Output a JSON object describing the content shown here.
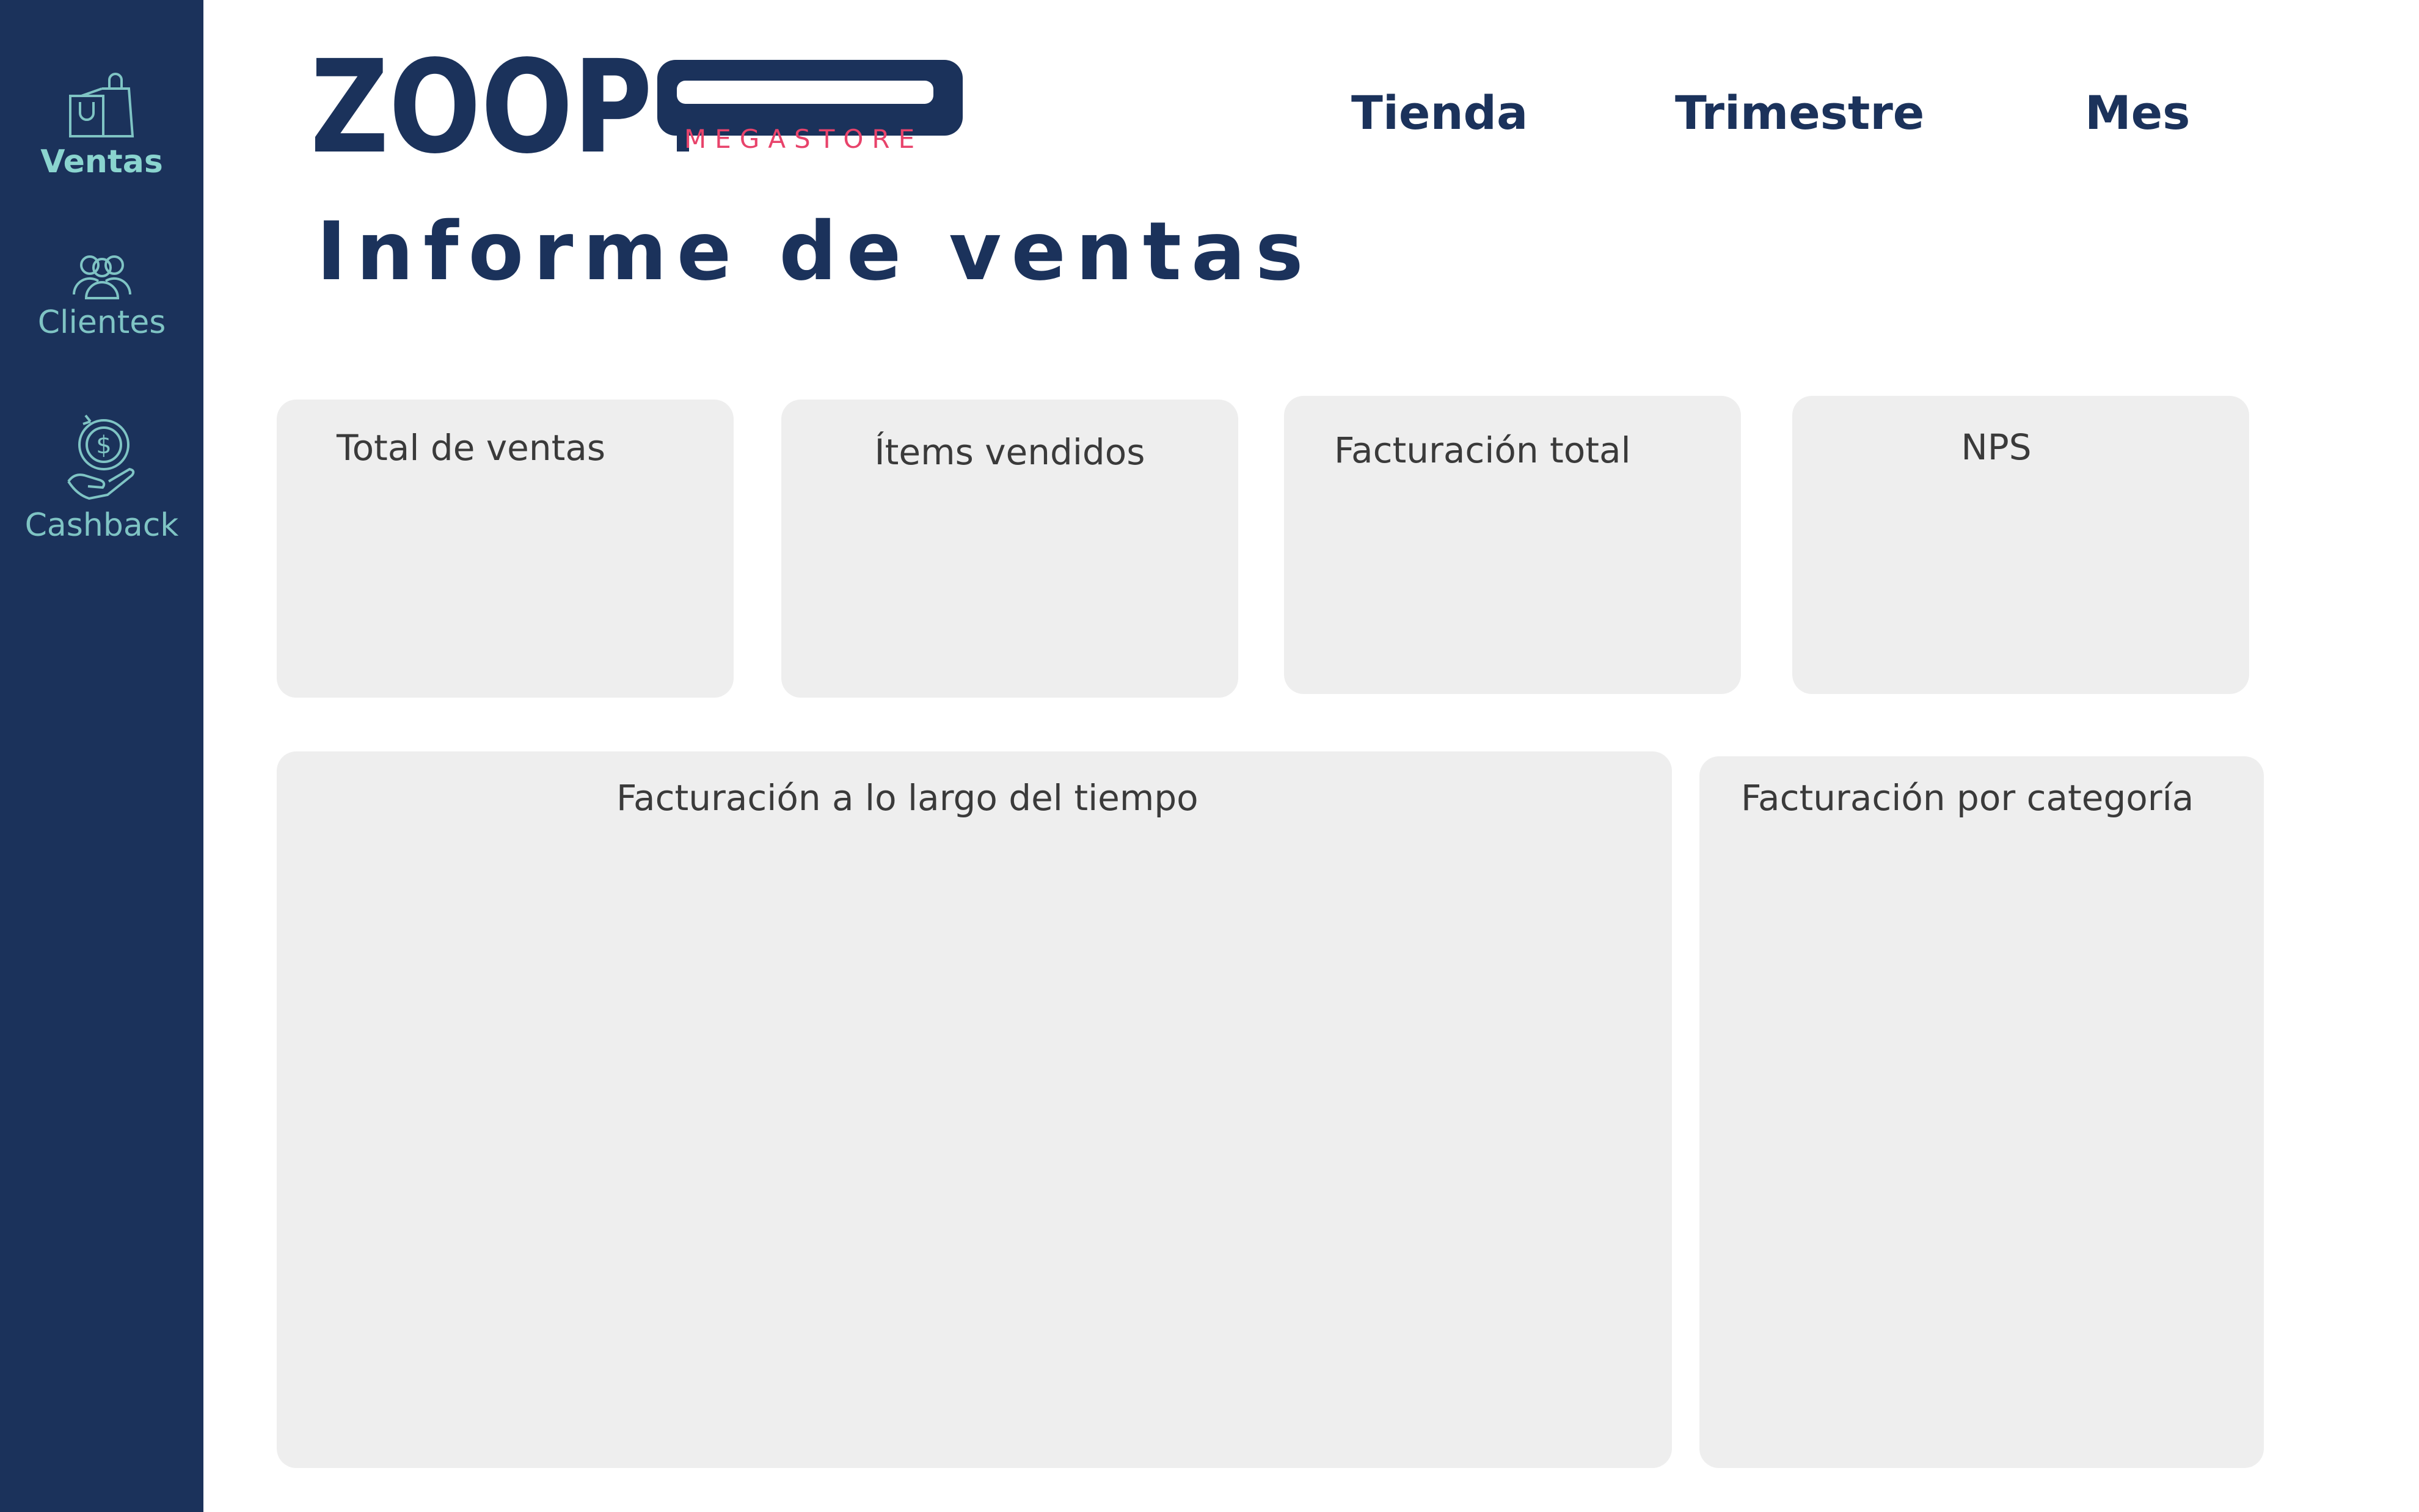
{
  "sidebar": {
    "items": [
      {
        "label": "Ventas",
        "icon": "shopping-bags-icon",
        "active": true
      },
      {
        "label": "Clientes",
        "icon": "users-icon",
        "active": false
      },
      {
        "label": "Cashback",
        "icon": "cashback-hand-icon",
        "active": false
      }
    ]
  },
  "header": {
    "logo": {
      "wordmark": "ZOOP",
      "subtitle": "MEGASTORE"
    },
    "filters": [
      "Tienda",
      "Trimestre",
      "Mes"
    ]
  },
  "page_title": "Informe de ventas",
  "cards": {
    "kpis": [
      "Total de ventas",
      "Ítems vendidos",
      "Facturación total",
      "NPS"
    ],
    "time_chart_title": "Facturación a lo largo del tiempo",
    "category_chart_title": "Facturación por categoría"
  },
  "colors": {
    "navy": "#1b325b",
    "teal_accent": "#7fc4c4",
    "logo_accent": "#e8436b",
    "card_bg": "#eeeeee"
  }
}
